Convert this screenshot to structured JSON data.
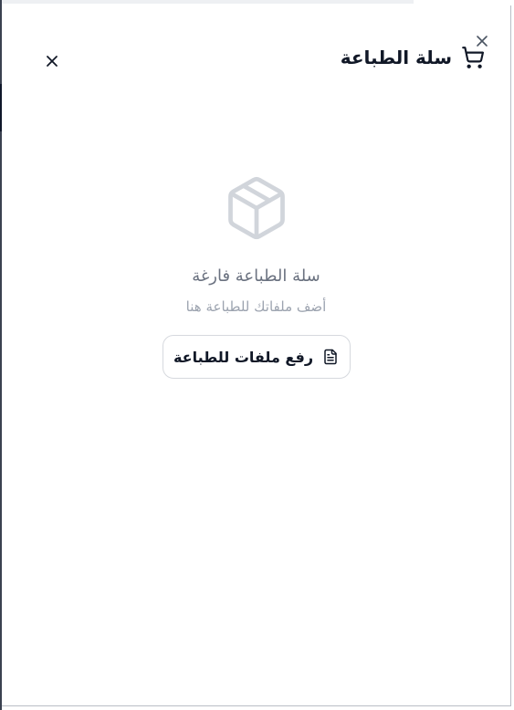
{
  "header": {
    "title": "سلة الطباعة",
    "icon": "shopping-cart-icon"
  },
  "empty_state": {
    "icon": "package-icon",
    "title": "سلة الطباعة فارغة",
    "subtitle": "أضف ملفاتك للطباعة هنا"
  },
  "upload_button": {
    "label": "رفع ملفات للطباعة",
    "icon": "file-text-icon"
  },
  "colors": {
    "title_text": "#111827",
    "muted_text": "#6b7280",
    "subtle_text": "#9ca3af",
    "icon_gray": "#d1d5db",
    "border": "#d6d9de"
  }
}
